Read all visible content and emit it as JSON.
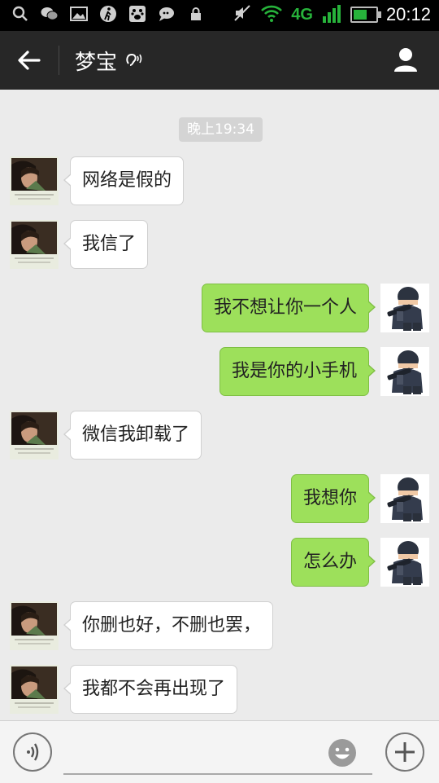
{
  "status_bar": {
    "network": "4G",
    "time": "20:12",
    "icons": [
      "search-icon",
      "wechat-icon",
      "image-icon",
      "walk-icon",
      "baidu-icon",
      "chat-bubble-icon",
      "lock-icon",
      "mute-icon",
      "wifi-icon",
      "signal-icon",
      "battery-icon"
    ]
  },
  "header": {
    "title": "梦宝",
    "earpiece_icon": "earpiece-mode-icon",
    "back_icon": "back-arrow-icon",
    "profile_icon": "person-icon"
  },
  "conversation": {
    "timestamp": "晚上19:34",
    "messages": [
      {
        "side": "left",
        "text": "网络是假的"
      },
      {
        "side": "left",
        "text": "我信了"
      },
      {
        "side": "right",
        "text": "我不想让你一个人"
      },
      {
        "side": "right",
        "text": "我是你的小手机"
      },
      {
        "side": "left",
        "text": "微信我卸载了"
      },
      {
        "side": "right",
        "text": "我想你"
      },
      {
        "side": "right",
        "text": "怎么办"
      },
      {
        "side": "left",
        "text": "你删也好，不删也罢，"
      },
      {
        "side": "left",
        "text": "我都不会再出现了"
      }
    ]
  },
  "input_bar": {
    "voice_icon": "voice-icon",
    "emoji_icon": "emoji-icon",
    "plus_icon": "plus-icon",
    "value": ""
  },
  "colors": {
    "status_bar_bg": "#000000",
    "title_bar_bg": "#272727",
    "chat_bg": "#ebebeb",
    "outgoing_bubble": "#9de05b",
    "incoming_bubble": "#ffffff",
    "network_green": "#27b33b"
  }
}
